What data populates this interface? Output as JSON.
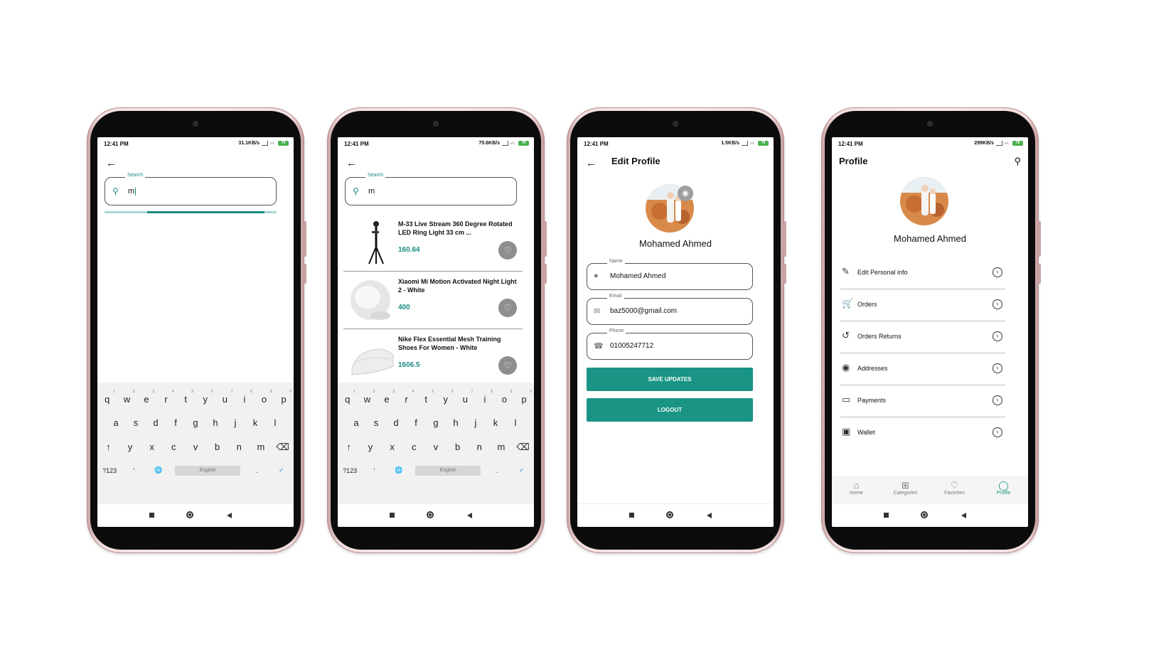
{
  "status": {
    "time": "12:41 PM",
    "speeds": [
      "31.1KB/s",
      "75.6KB/s",
      "1.5KB/s",
      "299KB/s"
    ],
    "battery": "79"
  },
  "search": {
    "label": "Search",
    "value": "m",
    "placeholder": ""
  },
  "keyboard": {
    "row1": [
      "q",
      "w",
      "e",
      "r",
      "t",
      "y",
      "u",
      "i",
      "o",
      "p"
    ],
    "row1_nums": [
      "1",
      "2",
      "3",
      "4",
      "5",
      "6",
      "7",
      "8",
      "9",
      "0"
    ],
    "row2": [
      "a",
      "s",
      "d",
      "f",
      "g",
      "h",
      "j",
      "k",
      "l"
    ],
    "row3": [
      "↑",
      "y",
      "x",
      "c",
      "v",
      "b",
      "n",
      "m",
      "⌫"
    ],
    "sym": "?123",
    "comma": "'",
    "lang": "English",
    "period": ".",
    "done": "✓"
  },
  "results": [
    {
      "title": "M-33 Live Stream 360 Degree Rotated LED Ring Light 33 cm ...",
      "price": "160.64"
    },
    {
      "title": "Xiaomi Mi Motion Activated Night Light 2 - White",
      "price": "400"
    },
    {
      "title": "Nike Flex Essential Mesh Training Shoes For Women - White",
      "price": "1606.5"
    }
  ],
  "edit_profile": {
    "title": "Edit Profile",
    "name": "Mohamed Ahmed",
    "fields": [
      {
        "label": "Name",
        "value": "Mohamed Ahmed",
        "icon": "person-icon"
      },
      {
        "label": "Email",
        "value": "baz5000@gmail.com",
        "icon": "mail-icon"
      },
      {
        "label": "Phone",
        "value": "01005247712",
        "icon": "phone-icon"
      }
    ],
    "save": "SAVE UPDATES",
    "logout": "LOGOUT"
  },
  "profile": {
    "title": "Profile",
    "name": "Mohamed Ahmed",
    "menu": [
      {
        "label": "Edit Personal info",
        "icon": "edit-icon"
      },
      {
        "label": "Orders",
        "icon": "cart-icon"
      },
      {
        "label": "Orders Returns",
        "icon": "history-icon"
      },
      {
        "label": "Addresses",
        "icon": "location-icon"
      },
      {
        "label": "Payments",
        "icon": "card-icon"
      },
      {
        "label": "Wallet",
        "icon": "wallet-icon"
      }
    ],
    "nav": [
      "Home",
      "Categories",
      "Favorites",
      "Profile"
    ]
  },
  "colors": {
    "accent": "#1a9485",
    "frame": "#f3dede"
  }
}
